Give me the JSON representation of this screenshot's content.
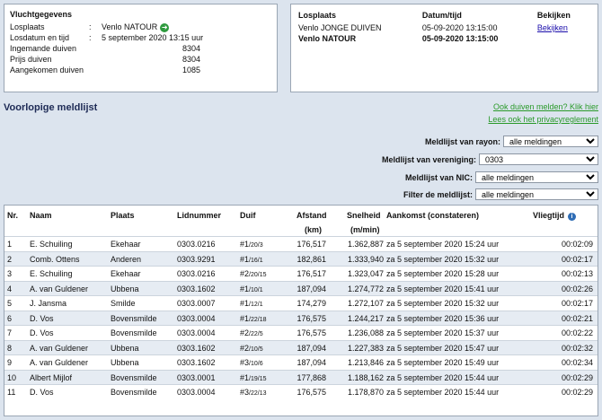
{
  "flight": {
    "title": "Vluchtgegevens",
    "rows": [
      {
        "label": "Losplaats",
        "sep": ":",
        "value": "Venlo NATOUR"
      },
      {
        "label": "Losdatum en tijd",
        "sep": ":",
        "value": "5 september 2020 13:15 uur"
      },
      {
        "label": "Ingemande duiven",
        "sep": "",
        "value": "8304"
      },
      {
        "label": "Prijs duiven",
        "sep": "",
        "value": "8304"
      },
      {
        "label": "Aangekomen duiven",
        "sep": "",
        "value": "1085"
      }
    ],
    "go_icon": "arrow-right-icon"
  },
  "release": {
    "headers": {
      "losplaats": "Losplaats",
      "datum": "Datum/tijd",
      "bekijken": "Bekijken"
    },
    "rows": [
      {
        "losplaats": "Venlo JONGE DUIVEN",
        "datum": "05-09-2020 13:15:00",
        "bekijken": "Bekijken"
      },
      {
        "losplaats": "Venlo NATOUR",
        "datum": "05-09-2020 13:15:00",
        "bekijken": ""
      }
    ]
  },
  "page_title": "Voorlopige meldlijst",
  "links": {
    "melden": "Ook duiven melden? Klik hier",
    "privacy": "Lees ook het privacyreglement"
  },
  "filters": [
    {
      "label": "Meldlijst van rayon:",
      "value": "alle meldingen"
    },
    {
      "label": "Meldlijst van vereniging:",
      "value": "0303"
    },
    {
      "label": "Meldlijst van NIC:",
      "value": "alle meldingen"
    },
    {
      "label": "Filter de meldlijst:",
      "value": "alle meldingen"
    }
  ],
  "table": {
    "headers": {
      "nr": "Nr.",
      "naam": "Naam",
      "plaats": "Plaats",
      "lid": "Lidnummer",
      "duif": "Duif",
      "afstand": "Afstand",
      "afstand_unit": "(km)",
      "snelheid": "Snelheid",
      "snelheid_unit": "(m/min)",
      "aankomst": "Aankomst (constateren)",
      "vliegtijd": "Vliegtijd"
    },
    "info_icon": "info-icon",
    "rows": [
      {
        "nr": "1",
        "naam": "E. Schuiling",
        "plaats": "Ekehaar",
        "lid": "0303.0216",
        "duif": "#1",
        "duif_sub": "/20/3",
        "afstand": "176,517",
        "snelheid": "1.362,887",
        "aankomst": "za 5 september 2020 15:24 uur",
        "vliegtijd": "00:02:09"
      },
      {
        "nr": "2",
        "naam": "Comb. Ottens",
        "plaats": "Anderen",
        "lid": "0303.9291",
        "duif": "#1",
        "duif_sub": "/16/1",
        "afstand": "182,861",
        "snelheid": "1.333,940",
        "aankomst": "za 5 september 2020 15:32 uur",
        "vliegtijd": "00:02:17"
      },
      {
        "nr": "3",
        "naam": "E. Schuiling",
        "plaats": "Ekehaar",
        "lid": "0303.0216",
        "duif": "#2",
        "duif_sub": "/20/15",
        "afstand": "176,517",
        "snelheid": "1.323,047",
        "aankomst": "za 5 september 2020 15:28 uur",
        "vliegtijd": "00:02:13"
      },
      {
        "nr": "4",
        "naam": "A. van Guldener",
        "plaats": "Ubbena",
        "lid": "0303.1602",
        "duif": "#1",
        "duif_sub": "/10/1",
        "afstand": "187,094",
        "snelheid": "1.274,772",
        "aankomst": "za 5 september 2020 15:41 uur",
        "vliegtijd": "00:02:26"
      },
      {
        "nr": "5",
        "naam": "J. Jansma",
        "plaats": "Smilde",
        "lid": "0303.0007",
        "duif": "#1",
        "duif_sub": "/12/1",
        "afstand": "174,279",
        "snelheid": "1.272,107",
        "aankomst": "za 5 september 2020 15:32 uur",
        "vliegtijd": "00:02:17"
      },
      {
        "nr": "6",
        "naam": "D. Vos",
        "plaats": "Bovensmilde",
        "lid": "0303.0004",
        "duif": "#1",
        "duif_sub": "/22/18",
        "afstand": "176,575",
        "snelheid": "1.244,217",
        "aankomst": "za 5 september 2020 15:36 uur",
        "vliegtijd": "00:02:21"
      },
      {
        "nr": "7",
        "naam": "D. Vos",
        "plaats": "Bovensmilde",
        "lid": "0303.0004",
        "duif": "#2",
        "duif_sub": "/22/5",
        "afstand": "176,575",
        "snelheid": "1.236,088",
        "aankomst": "za 5 september 2020 15:37 uur",
        "vliegtijd": "00:02:22"
      },
      {
        "nr": "8",
        "naam": "A. van Guldener",
        "plaats": "Ubbena",
        "lid": "0303.1602",
        "duif": "#2",
        "duif_sub": "/10/5",
        "afstand": "187,094",
        "snelheid": "1.227,383",
        "aankomst": "za 5 september 2020 15:47 uur",
        "vliegtijd": "00:02:32"
      },
      {
        "nr": "9",
        "naam": "A. van Guldener",
        "plaats": "Ubbena",
        "lid": "0303.1602",
        "duif": "#3",
        "duif_sub": "/10/6",
        "afstand": "187,094",
        "snelheid": "1.213,846",
        "aankomst": "za 5 september 2020 15:49 uur",
        "vliegtijd": "00:02:34"
      },
      {
        "nr": "10",
        "naam": "Albert Mijlof",
        "plaats": "Bovensmilde",
        "lid": "0303.0001",
        "duif": "#1",
        "duif_sub": "/19/15",
        "afstand": "177,868",
        "snelheid": "1.188,162",
        "aankomst": "za 5 september 2020 15:44 uur",
        "vliegtijd": "00:02:29"
      },
      {
        "nr": "11",
        "naam": "D. Vos",
        "plaats": "Bovensmilde",
        "lid": "0303.0004",
        "duif": "#3",
        "duif_sub": "/22/13",
        "afstand": "176,575",
        "snelheid": "1.178,870",
        "aankomst": "za 5 september 2020 15:44 uur",
        "vliegtijd": "00:02:29"
      }
    ]
  }
}
